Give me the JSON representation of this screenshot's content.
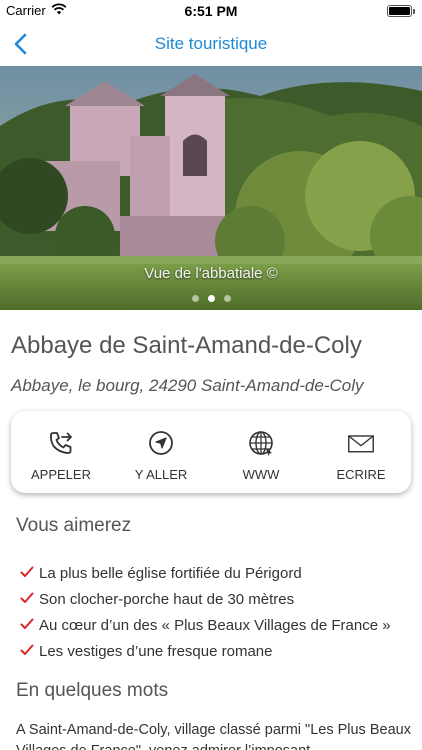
{
  "status_bar": {
    "carrier": "Carrier",
    "time": "6:51 PM"
  },
  "nav": {
    "title": "Site touristique",
    "accent_color": "#1e8ad6"
  },
  "hero": {
    "caption": "Vue de l'abbatiale ©",
    "page_count": 3,
    "current_page": 2
  },
  "place": {
    "title": "Abbaye de Saint-Amand-de-Coly",
    "address": "Abbaye, le bourg, 24290 Saint-Amand-de-Coly"
  },
  "actions": [
    {
      "label": "APPELER",
      "icon": "phone-forward-icon"
    },
    {
      "label": "Y ALLER",
      "icon": "navigation-arrow-icon"
    },
    {
      "label": "WWW",
      "icon": "globe-icon"
    },
    {
      "label": "ECRIRE",
      "icon": "envelope-icon"
    }
  ],
  "likes": {
    "heading": "Vous aimerez",
    "check_color": "#d9262b",
    "items": [
      "La plus belle église fortifiée du Périgord",
      "Son clocher-porche haut de 30 mètres",
      "Au cœur d’un des « Plus Beaux Villages de France »",
      "Les vestiges d’une fresque romane"
    ]
  },
  "summary": {
    "heading": "En quelques mots",
    "text": "A Saint-Amand-de-Coly, village classé parmi \"Les Plus Beaux Villages de France\", venez admirer l’imposant"
  }
}
